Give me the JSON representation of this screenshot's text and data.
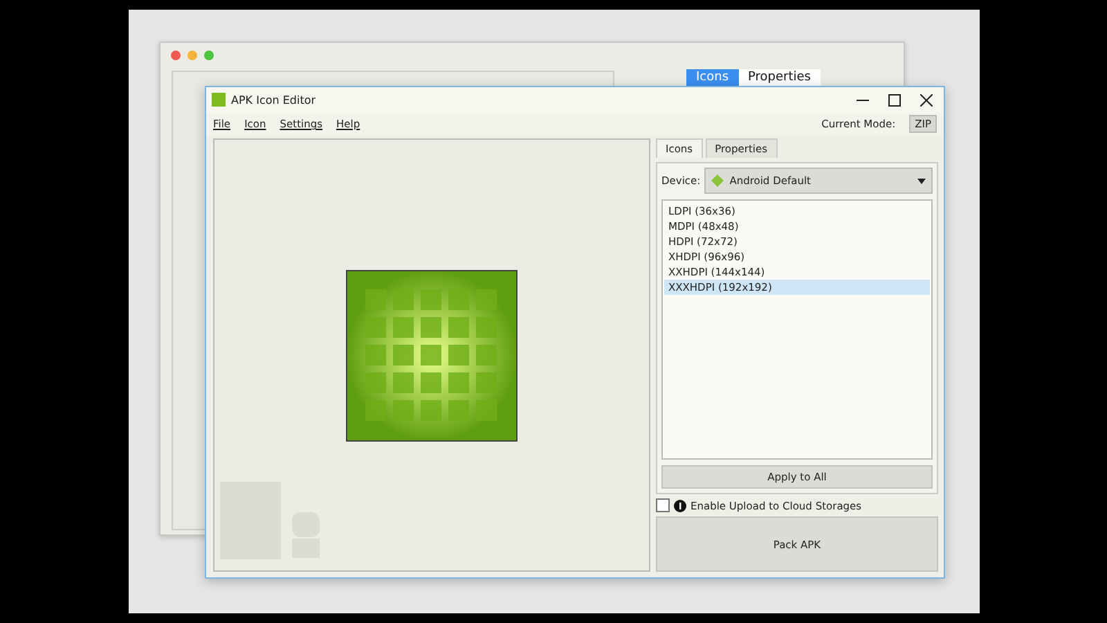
{
  "back_window": {
    "tabs": [
      {
        "label": "Icons",
        "selected": true
      },
      {
        "label": "Properties",
        "selected": false
      }
    ]
  },
  "window": {
    "title": "APK Icon Editor"
  },
  "menu": [
    "File",
    "Icon",
    "Settings",
    "Help"
  ],
  "current_mode": {
    "label": "Current Mode:",
    "value": "ZIP"
  },
  "tabs": [
    {
      "label": "Icons",
      "selected": true
    },
    {
      "label": "Properties",
      "selected": false
    }
  ],
  "device": {
    "label": "Device:",
    "value": "Android Default"
  },
  "sizes": [
    {
      "label": "LDPI (36x36)",
      "selected": false
    },
    {
      "label": "MDPI (48x48)",
      "selected": false
    },
    {
      "label": "HDPI (72x72)",
      "selected": false
    },
    {
      "label": "XHDPI (96x96)",
      "selected": false
    },
    {
      "label": "XXHDPI (144x144)",
      "selected": false
    },
    {
      "label": "XXXHDPI (192x192)",
      "selected": true
    }
  ],
  "apply_button": "Apply to All",
  "cloud_upload": {
    "label": "Enable Upload to Cloud Storages",
    "checked": false
  },
  "pack_button": "Pack APK"
}
